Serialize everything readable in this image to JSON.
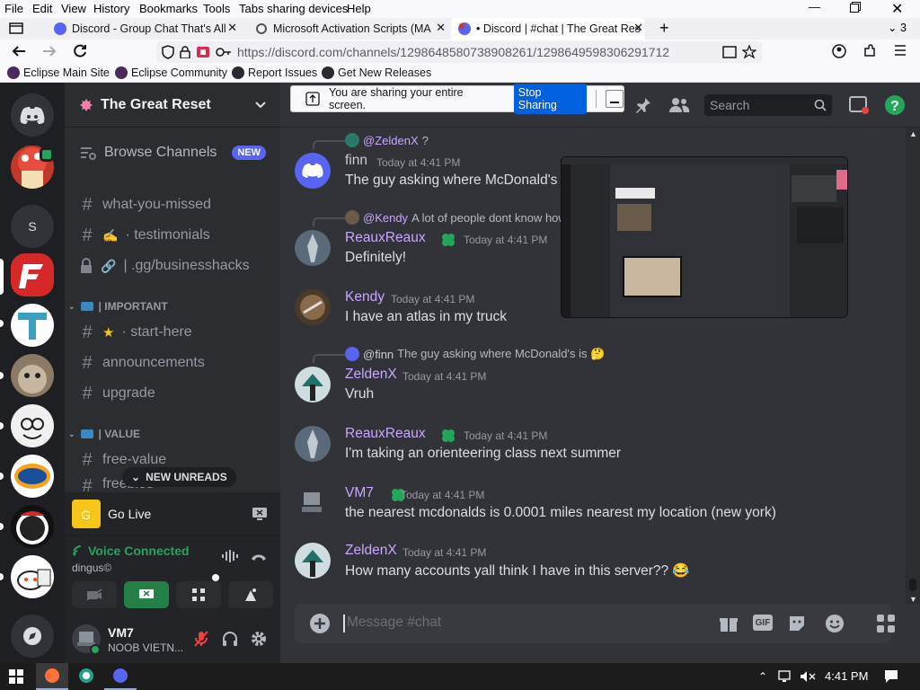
{
  "browser": {
    "menu": [
      "File",
      "Edit",
      "View",
      "History",
      "Bookmarks",
      "Tools",
      "Tabs sharing devices",
      "Help"
    ],
    "tabs": [
      {
        "label": "Discord - Group Chat That's All"
      },
      {
        "label": "Microsoft Activation Scripts (MA"
      },
      {
        "label": "• Discord | #chat | The Great Res"
      }
    ],
    "tab_count": "3",
    "url": "https://discord.com/channels/1298648580738908261/1298649598306291712",
    "bookmarks": [
      "Eclipse Main Site",
      "Eclipse Community",
      "Report Issues",
      "Get New Releases"
    ]
  },
  "share_banner": {
    "text": "You are sharing your entire screen.",
    "stop": "Stop Sharing"
  },
  "server": {
    "name": "The Great Reset"
  },
  "channels": {
    "browse": "Browse Channels",
    "new_badge": "NEW",
    "c1": "what-you-missed",
    "c2": "· testimonials",
    "c3": "| .gg/businesshacks",
    "cat1": "| IMPORTANT",
    "c4": "· start-here",
    "c5": "announcements",
    "c6": "upgrade",
    "cat2": "| VALUE",
    "c7": "free-value",
    "c8": "freebies",
    "new_unreads": "NEW UNREADS"
  },
  "server_letter": "S",
  "golive": {
    "label": "Go Live"
  },
  "voice": {
    "status": "Voice Connected",
    "channel": "dingus©"
  },
  "user": {
    "name": "VM7",
    "sub": "NOOB VIETN..."
  },
  "header": {
    "search": "Search"
  },
  "messages": [
    {
      "reply_user": "@ZeldenX",
      "reply_text": "?",
      "user": "finn",
      "time": "Today at 4:41 PM",
      "text": "The guy asking where McDonald's is"
    },
    {
      "reply_user": "@Kendy",
      "reply_text": "A lot of people dont know how",
      "user": "ReauxReaux",
      "time": "Today at 4:41 PM",
      "text": "Definitely!"
    },
    {
      "user": "Kendy",
      "time": "Today at 4:41 PM",
      "text": "I have an atlas in my truck"
    },
    {
      "reply_user": "@finn",
      "reply_text": "The guy asking where McDonald's is 🤔",
      "user": "ZeldenX",
      "time": "Today at 4:41 PM",
      "text": "Vruh"
    },
    {
      "user": "ReauxReaux",
      "time": "Today at 4:41 PM",
      "text": "I'm taking an orienteering class next summer"
    },
    {
      "user": "VM7",
      "time": "Today at 4:41 PM",
      "text": "the nearest mcdonalds is 0.0001 miles nearest my location (new york)"
    },
    {
      "user": "ZeldenX",
      "time": "Today at 4:41 PM",
      "text": "How many accounts yall think I have in this server?? 😂"
    }
  ],
  "composer": {
    "placeholder": "Message #chat",
    "gif": "GIF"
  },
  "taskbar": {
    "time": "4:41 PM"
  },
  "colors": {
    "blurple": "#5865f2",
    "green": "#23a55a",
    "name_purple": "#c9a6ff",
    "name_gray": "#c9cdd3"
  }
}
